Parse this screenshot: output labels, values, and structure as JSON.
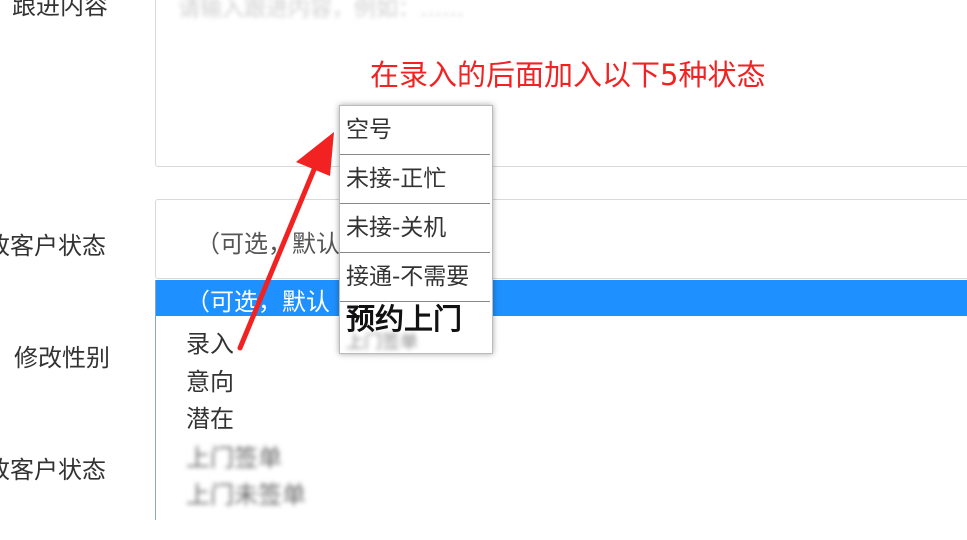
{
  "form": {
    "followup_label": "跟进内容",
    "followup_placeholder": "请输入跟进内容，例如：……",
    "status_label_1": "改客户状态",
    "status_select_value": "（可选，默认",
    "gender_label": "修改性别",
    "status_label_2": "改客户状态"
  },
  "dropdown": {
    "options": [
      "（可选，默认",
      "录入",
      "意向",
      "潜在",
      "上门签单",
      "上门未签单"
    ]
  },
  "annotation": {
    "text": "在录入的后面加入以下5种状态",
    "color": "#f22222"
  },
  "popup": {
    "items": [
      "空号",
      "未接-正忙",
      "未接-关机",
      "接通-不需要",
      "预约上门"
    ],
    "trailing_blur": "上门签单"
  },
  "colors": {
    "selected_bg": "#1e90ff",
    "arrow": "#f22222"
  }
}
